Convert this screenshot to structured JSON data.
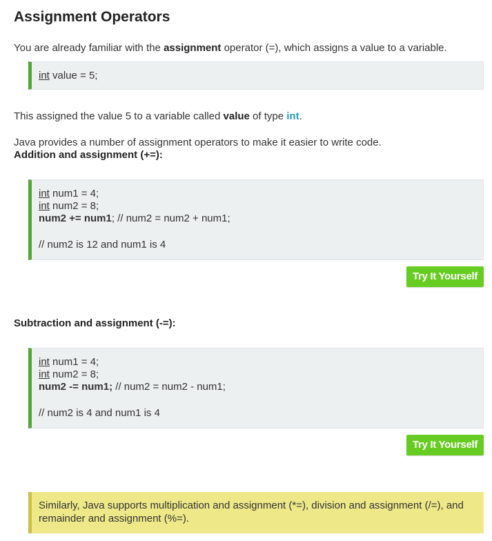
{
  "title": "Assignment Operators",
  "intro": {
    "pre": "You are already familiar with the ",
    "bold": "assignment",
    "post": " operator (=), which assigns a value to a variable."
  },
  "code1": {
    "kw": "int",
    "rest": " value = 5;"
  },
  "para2": {
    "pre": "This assigned the value 5 to a variable called ",
    "bold": "value",
    "mid": " of type ",
    "kw": "int",
    "post": "."
  },
  "para3": "Java provides a number of assignment operators to make it easier to write code.",
  "section1": {
    "heading": "Addition and assignment (+=):",
    "line1_kw": "int",
    "line1_rest": " num1 = 4;",
    "line2_kw": "int",
    "line2_rest": " num2 = 8;",
    "line3_bold": "num2 += num1",
    "line3_rest": "; // num2 = num2 + num1;",
    "line4": "// num2 is 12 and num1 is 4",
    "button": "Try It Yourself"
  },
  "section2": {
    "heading": "Subtraction and assignment (-=):",
    "line1_kw": "int",
    "line1_rest": " num1 = 4;",
    "line2_kw": "int",
    "line2_rest": " num2 = 8;",
    "line3_bold": "num2 -= num1;",
    "line3_rest": " // num2 = num2 - num1;",
    "line4": "// num2 is 4 and num1 is 4",
    "button": "Try It Yourself"
  },
  "note": "Similarly, Java supports multiplication and assignment (*=), division and assignment (/=), and remainder and assignment (%=).",
  "colors": {
    "code_border": "#4fa834",
    "code_bg": "#ecf0f1",
    "button_bg": "#66cc22",
    "keyword": "#2a9cc0",
    "note_bg": "#eee888",
    "note_border": "#c9c04a"
  }
}
